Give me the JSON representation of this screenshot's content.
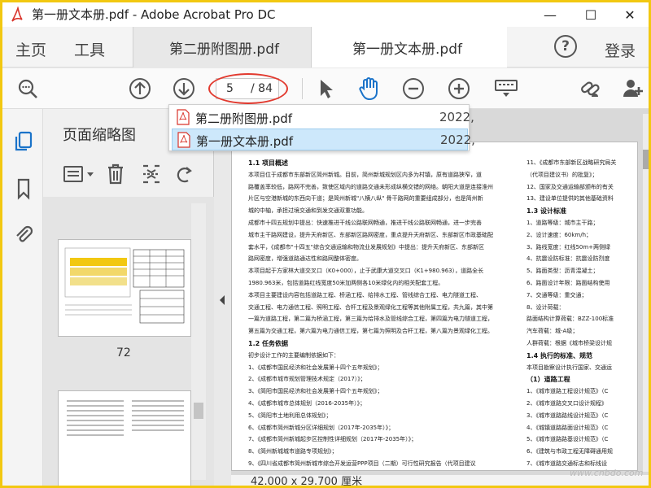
{
  "window": {
    "title": "第一册文本册.pdf - Adobe Acrobat Pro DC",
    "minimize": "—",
    "maximize": "☐",
    "close": "✕"
  },
  "tabs": {
    "home": "主页",
    "tools": "工具",
    "docs": [
      {
        "label": "第二册附图册.pdf",
        "close": "✕",
        "active": false
      },
      {
        "label": "第一册文本册.pdf",
        "close": "✕",
        "active": true
      }
    ],
    "help": "?",
    "login": "登录"
  },
  "toolbar": {
    "current_page": "5",
    "total_pages": "/ 84",
    "icons": [
      "zoom-icon",
      "page-up-icon",
      "page-down-icon",
      "select-arrow-icon",
      "hand-icon",
      "zoom-out-icon",
      "zoom-in-icon",
      "keyboard-icon",
      "link-icon",
      "add-user-icon"
    ]
  },
  "dropdown": {
    "items": [
      {
        "name": "第二册附图册.pdf",
        "date": "2022,",
        "selected": false
      },
      {
        "name": "第一册文本册.pdf",
        "date": "2022,",
        "selected": true
      }
    ]
  },
  "thumbnails": {
    "title": "页面缩略图",
    "pages": [
      {
        "number": "72"
      }
    ]
  },
  "document": {
    "left": [
      {
        "t": "h",
        "text": "1.1 项目概述"
      },
      {
        "t": "p",
        "text": "本项目位于成都市东部新区简州新城。目前，简州新城规划区内多为村镇，原有道路狭窄，道"
      },
      {
        "t": "p",
        "text": "路覆盖率较低，路网不完善，致使区域内的道路交通未形成纵横交错的网络。朝阳大道是连接淮州"
      },
      {
        "t": "p",
        "text": "片区与空港新城的东西向干道；是简州新城\"八横八纵\" 骨干路网的重要组成部分，也是简州新"
      },
      {
        "t": "p",
        "text": "城的中轴，承担过境交通和到发交通双重功能。"
      },
      {
        "t": "p",
        "text": "成都市十四五规划中提出：快速推进干线公路联网畅通，推进干线公路联网畅通，进一步完善"
      },
      {
        "t": "p",
        "text": "城市主干路网建设，提升天府新区、东部新区路网密度，重点提升天府新区、东部新区市政基础配"
      },
      {
        "t": "p",
        "text": "套水平，《成都市\"十四五\"综合交通运输和物流业发展规划》中提出：提升天府新区、东部新区"
      },
      {
        "t": "p",
        "text": "路网密度，增强道路通达性和路网整体密度。"
      },
      {
        "t": "p",
        "text": "本项目起于方家林大道交叉口（K0+000），止于武康大道交叉口（K1+980.963），道路全长"
      },
      {
        "t": "p",
        "text": "1980.963米，包括道路红线宽度50米加两侧各10米绿化内的相关配套工程。"
      },
      {
        "t": "p",
        "text": "本项目主要建设内容包括道路工程、桥涵工程、给排水工程、管线综合工程、电力隧道工程、"
      },
      {
        "t": "p",
        "text": "交通工程、电力通信工程、照明工程、合杆工程及景观绿化工程等其他附属工程，共九篇，其中第"
      },
      {
        "t": "p",
        "text": "一篇为道路工程，第二篇为桥涵工程，第三篇为给排水及管线综合工程，第四篇为电力隧道工程，"
      },
      {
        "t": "p",
        "text": "第五篇为交通工程，第六篇为电力通信工程，第七篇为照明及合杆工程，第八篇为景观绿化工程。"
      },
      {
        "t": "h",
        "text": "1.2 任务依据"
      },
      {
        "t": "p",
        "text": "初步设计工作的主要编制依据如下："
      },
      {
        "t": "p",
        "text": "1、《成都市国民经济和社会发展第十四个五年规划》；"
      },
      {
        "t": "p",
        "text": "2、《成都市城市规划管理技术规定（2017）》；"
      },
      {
        "t": "p",
        "text": "3、《简阳市国民经济和社会发展第十四个五年规划》；"
      },
      {
        "t": "p",
        "text": "4、《成都市城市总体规划（2016-2035年）》；"
      },
      {
        "t": "p",
        "text": "5、《简阳市土地利用总体规划》；"
      },
      {
        "t": "p",
        "text": "6、《成都市简州新城分区详细规划（2017年-2035年）》；"
      },
      {
        "t": "p",
        "text": "7、《成都市简州新城起步区控制性详细规划（2017年-2035年）》；"
      },
      {
        "t": "p",
        "text": "8、《简州新城城市道路专项规划》；"
      },
      {
        "t": "p",
        "text": "9、《四川省成都市简州新城市综合开发运营PPP项目（二期）可行性研究报告（代项目建议"
      }
    ],
    "right": [
      {
        "t": "p",
        "text": "11、《成都市东部新区战略研究局关"
      },
      {
        "t": "p",
        "text": "（代项目建议书）的批复》；"
      },
      {
        "t": "p",
        "text": "12、国家及交通运输部颁布的有关"
      },
      {
        "t": "p",
        "text": "13、建设单位提供的其他基础资料"
      },
      {
        "t": "h",
        "text": "1.3 设计标准"
      },
      {
        "t": "p",
        "text": "1、道路等级：城市主干路；"
      },
      {
        "t": "p",
        "text": "2、设计速度：60km/h；"
      },
      {
        "t": "p",
        "text": "3、路线宽度：红线50m+两侧绿"
      },
      {
        "t": "p",
        "text": "4、抗震设防标准：抗震设防烈度"
      },
      {
        "t": "p",
        "text": "5、路面类型：沥青混凝土；"
      },
      {
        "t": "p",
        "text": "6、路面设计年限：路面结构使用"
      },
      {
        "t": "p",
        "text": "7、交通等级：重交通；"
      },
      {
        "t": "p",
        "text": "8、设计荷载："
      },
      {
        "t": "p",
        "text": "路面结构计算荷载：BZZ-100标准"
      },
      {
        "t": "p",
        "text": "汽车荷载：城-A级；"
      },
      {
        "t": "p",
        "text": "人群荷载：根据《城市桥梁设计规"
      },
      {
        "t": "h",
        "text": "1.4 执行的标准、规范"
      },
      {
        "t": "p",
        "text": "本项目勘察设计执行国家、交通运"
      },
      {
        "t": "h",
        "text": "（1）道路工程"
      },
      {
        "t": "p",
        "text": "1、《城市道路工程设计规范》（C"
      },
      {
        "t": "p",
        "text": "2、《城市道路交叉口设计规程》"
      },
      {
        "t": "p",
        "text": "3、《城市道路路线设计规范》（C"
      },
      {
        "t": "p",
        "text": "4、《城镇道路路面设计规范》（C"
      },
      {
        "t": "p",
        "text": "5、《城市道路路基设计规范》（C"
      },
      {
        "t": "p",
        "text": "6、《建筑与市政工程无障碍通用规"
      },
      {
        "t": "p",
        "text": "7、《城市道路交通标志和标线设"
      },
      {
        "t": "p",
        "text": "8、《城市道路交通设施设计规范"
      }
    ]
  },
  "status": {
    "page_size": "42.000 x 29.700 厘米"
  },
  "watermark": "www.cnbdo.com",
  "colors": {
    "frame": "#f2c811",
    "annotation": "#e23a2f",
    "selection": "#cde8fb",
    "pdf_red": "#d9342b"
  }
}
